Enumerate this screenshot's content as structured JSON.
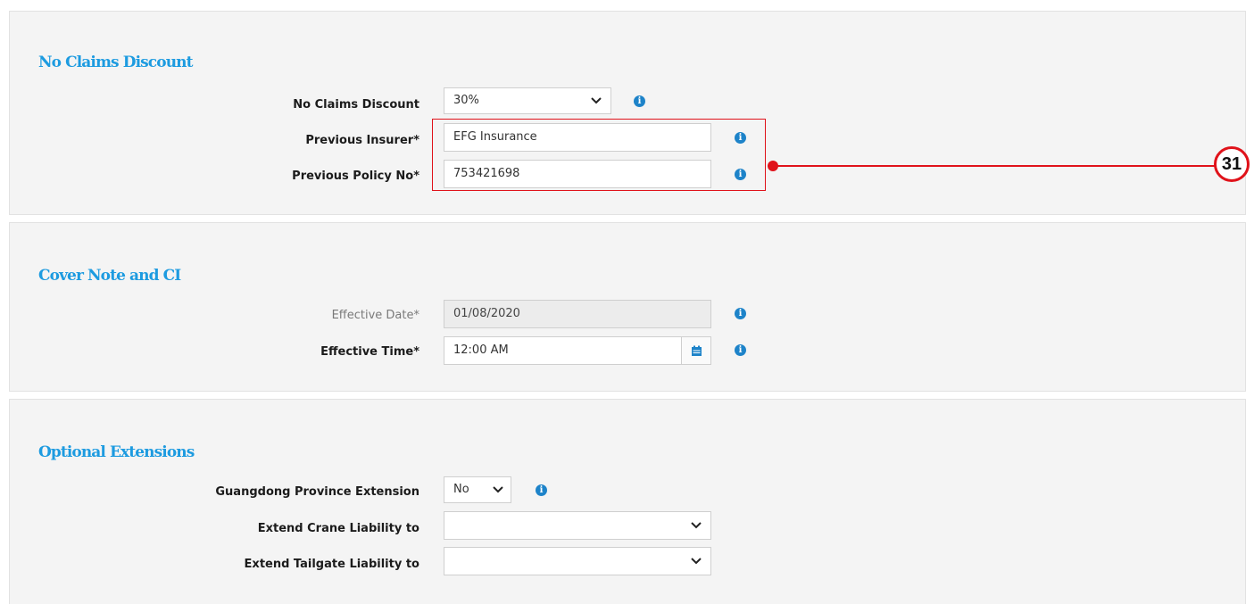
{
  "ncd_section": {
    "title": "No Claims Discount",
    "fields": {
      "discount": {
        "label": "No Claims Discount",
        "value": "30%"
      },
      "previous_insurer": {
        "label": "Previous Insurer*",
        "value": "EFG Insurance"
      },
      "previous_policy_no": {
        "label": "Previous Policy No*",
        "value": "753421698"
      }
    }
  },
  "cover_section": {
    "title": "Cover Note and CI",
    "fields": {
      "effective_date": {
        "label": "Effective Date*",
        "value": "01/08/2020"
      },
      "effective_time": {
        "label": "Effective Time*",
        "value": "12:00 AM"
      }
    }
  },
  "extensions_section": {
    "title": "Optional Extensions",
    "fields": {
      "guangdong": {
        "label": "Guangdong Province Extension",
        "value": "No"
      },
      "crane": {
        "label": "Extend Crane Liability to",
        "value": ""
      },
      "tailgate": {
        "label": "Extend Tailgate Liability to",
        "value": ""
      }
    }
  },
  "annotation": {
    "number": "31",
    "color": "#e0121a"
  },
  "colors": {
    "accent": "#1d9be0",
    "info_icon": "#1d83c9"
  },
  "icons": {
    "info": "info-circle-icon",
    "dropdown": "chevron-down-icon",
    "calendar": "calendar-icon"
  }
}
